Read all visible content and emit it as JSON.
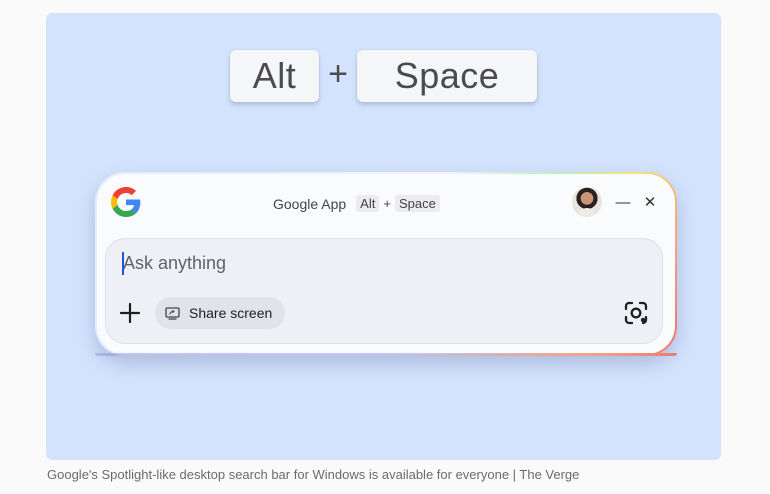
{
  "hero": {
    "shortcut": {
      "key1": "Alt",
      "plus": "+",
      "key2": "Space"
    }
  },
  "app_window": {
    "title": "Google App",
    "shortcut_key1": "Alt",
    "shortcut_plus": "+",
    "shortcut_key2": "Space",
    "icons": [
      "google-logo",
      "avatar",
      "minimize-icon",
      "close-icon",
      "plus-icon",
      "share-screen-icon",
      "lens-camera-icon"
    ],
    "minimize_glyph": "—",
    "close_glyph": "✕"
  },
  "search": {
    "placeholder": "Ask anything",
    "share_label": "Share screen"
  },
  "caption": "Google's Spotlight-like desktop search bar for Windows is available for  everyone | The Verge",
  "colors": {
    "background": "#d3e3fd",
    "panel": "#fafbfd",
    "input": "#eef0f6",
    "caret": "#1a56db"
  }
}
